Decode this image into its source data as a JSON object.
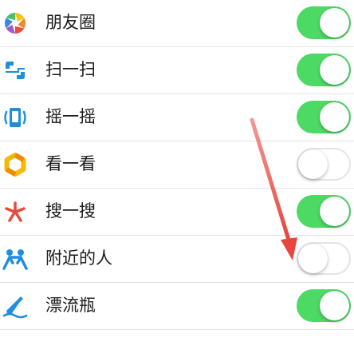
{
  "settings": {
    "items": [
      {
        "label": "朋友圈",
        "enabled": true,
        "icon": "moments-icon"
      },
      {
        "label": "扫一扫",
        "enabled": true,
        "icon": "scan-icon"
      },
      {
        "label": "摇一摇",
        "enabled": true,
        "icon": "shake-icon"
      },
      {
        "label": "看一看",
        "enabled": false,
        "icon": "top-stories-icon"
      },
      {
        "label": "搜一搜",
        "enabled": true,
        "icon": "search-icon"
      },
      {
        "label": "附近的人",
        "enabled": false,
        "icon": "people-nearby-icon"
      },
      {
        "label": "漂流瓶",
        "enabled": true,
        "icon": "drift-bottle-icon"
      }
    ]
  },
  "colors": {
    "toggle_on": "#4cd964",
    "annotation_arrow": "#e8463f"
  }
}
